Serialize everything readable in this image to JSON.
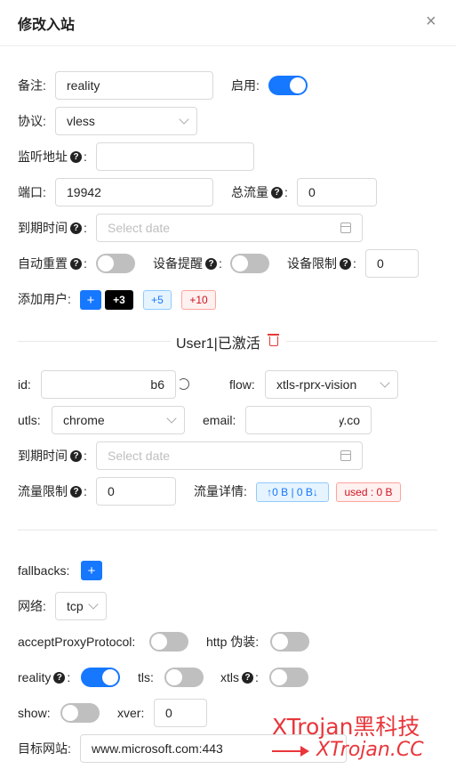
{
  "dialog": {
    "title": "修改入站",
    "close_glyph": "×"
  },
  "form": {
    "remark_label": "备注",
    "remark_value": "reality",
    "enable_label": "启用",
    "enable_on": true,
    "protocol_label": "协议",
    "protocol_value": "vless",
    "listen_label": "监听地址",
    "listen_value": "",
    "port_label": "端口",
    "port_value": "19942",
    "total_label": "总流量",
    "total_value": "0",
    "expiry_label": "到期时间",
    "date_placeholder": "Select date",
    "auto_reset_label": "自动重置",
    "auto_reset_on": false,
    "device_alert_label": "设备提醒",
    "device_alert_on": false,
    "device_limit_label": "设备限制",
    "device_limit_value": "0",
    "add_user_label": "添加用户",
    "add_plus": "+",
    "add_3": "+3",
    "add_5": "+5",
    "add_10": "+10",
    "colon": ":"
  },
  "user": {
    "section_title": "User1|已激活",
    "id_label": "id",
    "id_visible_tail": "b6",
    "flow_label": "flow",
    "flow_value": "xtls-rprx-vision",
    "utls_label": "utls",
    "utls_value": "chrome",
    "email_label": "email",
    "email_visible_tail": "y.co",
    "expiry_label": "到期时间",
    "date_placeholder": "Select date",
    "limit_label": "流量限制",
    "limit_value": "0",
    "detail_label": "流量详情",
    "detail_updown": "↑0 B | 0 B↓",
    "detail_used": "used : 0 B"
  },
  "transport": {
    "fallbacks_label": "fallbacks",
    "fallbacks_add": "+",
    "network_label": "网络",
    "network_value": "tcp",
    "accept_proxy_label": "acceptProxyProtocol",
    "accept_proxy_on": false,
    "http_fake_label": "http 伪装",
    "http_fake_on": false,
    "reality_label": "reality",
    "reality_on": true,
    "tls_label": "tls",
    "tls_on": false,
    "xtls_label": "xtls",
    "xtls_on": false,
    "show_label": "show",
    "show_on": false,
    "xver_label": "xver",
    "xver_value": "0",
    "target_label": "目标网站",
    "target_value": "www.microsoft.com:443"
  },
  "watermark": {
    "line1": "XTrojan黑科技",
    "line2": "XTrojan.CC"
  },
  "colors": {
    "accent": "#1677ff",
    "danger": "#e53935",
    "watermark": "#e8363b"
  },
  "icons": {
    "help": "question-circle-icon",
    "calendar": "calendar-icon",
    "chevron": "chevron-down-icon",
    "trash": "trash-icon",
    "refresh": "refresh-icon",
    "close": "close-icon"
  }
}
